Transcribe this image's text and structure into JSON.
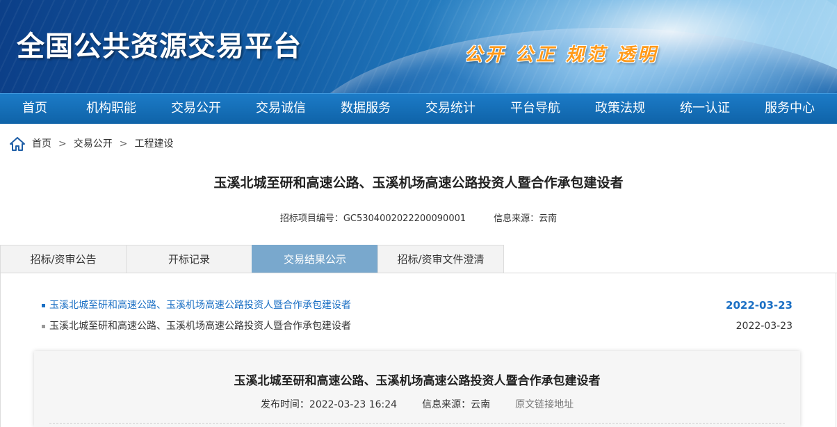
{
  "banner": {
    "title": "全国公共资源交易平台",
    "slogan": "公开 公正 规范 透明"
  },
  "nav": {
    "items": [
      "首页",
      "机构职能",
      "交易公开",
      "交易诚信",
      "数据服务",
      "交易统计",
      "平台导航",
      "政策法规",
      "统一认证",
      "服务中心"
    ]
  },
  "breadcrumb": {
    "icon": "home-icon",
    "items": [
      "首页",
      "交易公开",
      "工程建设"
    ],
    "separator": ">"
  },
  "project": {
    "title": "玉溪北城至研和高速公路、玉溪机场高速公路投资人暨合作承包建设者",
    "code_label": "招标项目编号：",
    "code": "GC5304002022200090001",
    "source_label": "信息来源：",
    "source": "云南"
  },
  "tabs": {
    "items": [
      "招标/资审公告",
      "开标记录",
      "交易结果公示",
      "招标/资审文件澄清"
    ],
    "active": "交易结果公示"
  },
  "list": [
    {
      "title": "玉溪北城至研和高速公路、玉溪机场高速公路投资人暨合作承包建设者",
      "date": "2022-03-23",
      "active": true
    },
    {
      "title": "玉溪北城至研和高速公路、玉溪机场高速公路投资人暨合作承包建设者",
      "date": "2022-03-23",
      "active": false
    }
  ],
  "detail": {
    "title": "玉溪北城至研和高速公路、玉溪机场高速公路投资人暨合作承包建设者",
    "publish_label": "发布时间：",
    "publish_time": "2022-03-23 16:24",
    "source_label": "信息来源：",
    "source": "云南",
    "link_label": "原文链接地址"
  },
  "colors": {
    "nav_bg": "#1469b2",
    "active_tab": "#79a8cd",
    "active_link": "#1a6fc4",
    "slogan": "#ff9a1a"
  }
}
